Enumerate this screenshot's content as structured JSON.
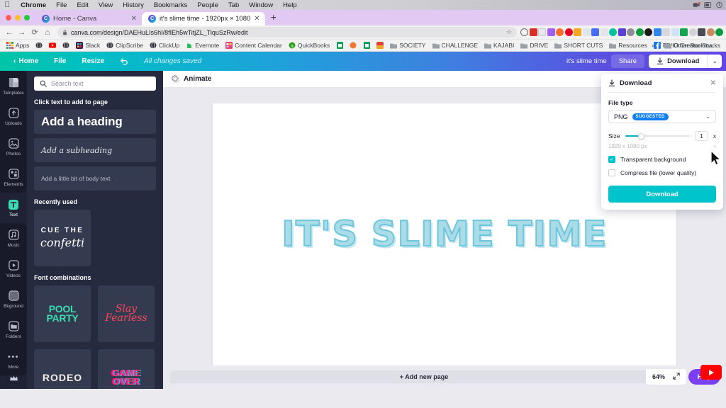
{
  "os_menubar": {
    "apple_glyph": "",
    "items": [
      "Chrome",
      "File",
      "Edit",
      "View",
      "History",
      "Bookmarks",
      "People",
      "Tab",
      "Window",
      "Help"
    ],
    "tray_icons": [
      "camera-icon",
      "battery-icon",
      "clock-icon"
    ]
  },
  "browser": {
    "tabs": [
      {
        "title": "Home - Canva",
        "favicon": "canva-icon",
        "active": false,
        "close": "✕"
      },
      {
        "title": "it's slime time - 1920px × 1080",
        "favicon": "canva-icon",
        "active": true,
        "close": "✕"
      }
    ],
    "new_tab_label": "+",
    "nav": {
      "back": "←",
      "forward": "→",
      "reload": "⟳",
      "home": "⌂"
    },
    "omnibox": {
      "lock_icon": "lock-icon",
      "url": "canva.com/design/DAEHuLIs6hI/8fIEh5wTitjZL_TiquSzRw/edit",
      "star_icon": "☆"
    },
    "extension_icons": [
      "info-icon",
      "screencastify-icon",
      "grammarly-icon",
      "evernote-webclipper-icon",
      "hootsuite-icon",
      "pinterest-icon",
      "trello-icon",
      "eyedropper-icon",
      "loom-icon",
      "screenshot-icon",
      "canva-ext-icon",
      "tailwind-icon",
      "privacy-icon",
      "rescuetime-icon",
      "adblock-icon",
      "bluesky-icon",
      "scissors-icon",
      "dropbox-icon",
      "notes-icon",
      "settings-icon",
      "puzzle-icon",
      "profile-avatar",
      "extension-green-icon"
    ],
    "bookmarks": [
      {
        "label": "Apps",
        "icon": "apps-grid-icon"
      },
      {
        "label": "",
        "icon": "globe-dark-icon"
      },
      {
        "label": "",
        "icon": "youtube-icon"
      },
      {
        "label": "",
        "icon": "globe-dark-icon"
      },
      {
        "label": "Slack",
        "icon": "slack-icon"
      },
      {
        "label": "ClipScribe",
        "icon": "globe-dark-icon"
      },
      {
        "label": "ClickUp",
        "icon": "globe-dark-icon"
      },
      {
        "label": "Evernote",
        "icon": "evernote-icon"
      },
      {
        "label": "Content Calendar",
        "icon": "calendar-icon"
      },
      {
        "label": "QuickBooks",
        "icon": "quickbooks-icon"
      },
      {
        "label": "",
        "icon": "sheets-icon"
      },
      {
        "label": "",
        "icon": "orange-circle-icon"
      },
      {
        "label": "",
        "icon": "sheets-icon"
      },
      {
        "label": "",
        "icon": "colorful-icon"
      },
      {
        "label": "SOCIETY",
        "icon": "folder-icon"
      },
      {
        "label": "CHALLENGE",
        "icon": "folder-icon"
      },
      {
        "label": "KAJABI",
        "icon": "folder-icon"
      },
      {
        "label": "DRIVE",
        "icon": "folder-icon"
      },
      {
        "label": "SHORT CUTS",
        "icon": "folder-icon"
      },
      {
        "label": "Resources",
        "icon": "folder-icon"
      },
      {
        "label": "FB/IG Creator Stu...",
        "icon": "facebook-icon"
      }
    ],
    "overflow_label": "»",
    "other_bookmarks": {
      "label": "Other Bookmarks",
      "icon": "folder-icon"
    }
  },
  "canva": {
    "topbar": {
      "home_label": "Home",
      "file_label": "File",
      "resize_label": "Resize",
      "undo_icon": "undo-icon",
      "save_status": "All changes saved",
      "doc_name": "it's slime time",
      "share_label": "Share",
      "download_label": "Download",
      "download_caret": "⌄"
    },
    "rail": [
      {
        "label": "Templates",
        "icon": "templates-icon",
        "active": false
      },
      {
        "label": "Uploads",
        "icon": "uploads-icon",
        "active": false
      },
      {
        "label": "Photos",
        "icon": "photos-icon",
        "active": false
      },
      {
        "label": "Elements",
        "icon": "elements-icon",
        "active": false
      },
      {
        "label": "Text",
        "icon": "text-icon",
        "active": true
      },
      {
        "label": "Music",
        "icon": "music-icon",
        "active": false
      },
      {
        "label": "Videos",
        "icon": "videos-icon",
        "active": false
      },
      {
        "label": "Bkground",
        "icon": "background-icon",
        "active": false
      },
      {
        "label": "Folders",
        "icon": "folders-icon",
        "active": false
      },
      {
        "label": "More",
        "icon": "more-dots-icon",
        "active": false
      }
    ],
    "rail_crown_icon": "crown-icon",
    "panel": {
      "search_placeholder": "Search text",
      "search_icon": "search-icon",
      "click_heading": "Click text to add to page",
      "cards": [
        {
          "label": "Add a heading",
          "style": "heading"
        },
        {
          "label": "Add a subheading",
          "style": "sub"
        },
        {
          "label": "Add a little bit of body text",
          "style": "body"
        }
      ],
      "recently_used_heading": "Recently used",
      "recent_items": [
        {
          "line1": "CUE THE",
          "line2": "confetti"
        }
      ],
      "font_combinations_heading": "Font combinations",
      "font_combos": [
        {
          "text": "POOL PARTY",
          "style": "pool"
        },
        {
          "text": "Slay Fearless",
          "style": "slay"
        },
        {
          "text": "RODEO",
          "style": "rodeo"
        },
        {
          "text": "GAME OVER",
          "style": "game"
        }
      ],
      "collapse_icon": "‹"
    },
    "editor": {
      "animate_label": "Animate",
      "animate_icon": "animate-icon",
      "canvas_text": "IT'S SLIME TIME",
      "add_page_label": "+ Add new page",
      "zoom_level": "64%",
      "fullscreen_icon": "expand-icon",
      "help_label": "Help",
      "help_video_icon": "youtube-play-icon"
    },
    "download_panel": {
      "title": "Download",
      "title_icon": "download-icon",
      "close_icon": "✕",
      "file_type_label": "File type",
      "file_type_value": "PNG",
      "file_type_badge": "SUGGESTED",
      "file_type_caret": "⌄",
      "size_label": "Size",
      "size_multiplier": "1",
      "size_unit": "x",
      "dimensions": "1920 x 1080 px",
      "transparent_label": "Transparent background",
      "transparent_checked": true,
      "compress_label": "Compress file (lower quality)",
      "compress_checked": false,
      "download_button": "Download"
    }
  },
  "colors": {
    "canva_teal": "#00c4cc",
    "canva_purple": "#7a3ff2",
    "panel_dark": "#252a3e",
    "rail_dark": "#1f2235",
    "slime_fill": "#aadce8",
    "slime_stroke": "#6ec6dd",
    "suggested_badge": "#0d7ff2"
  }
}
